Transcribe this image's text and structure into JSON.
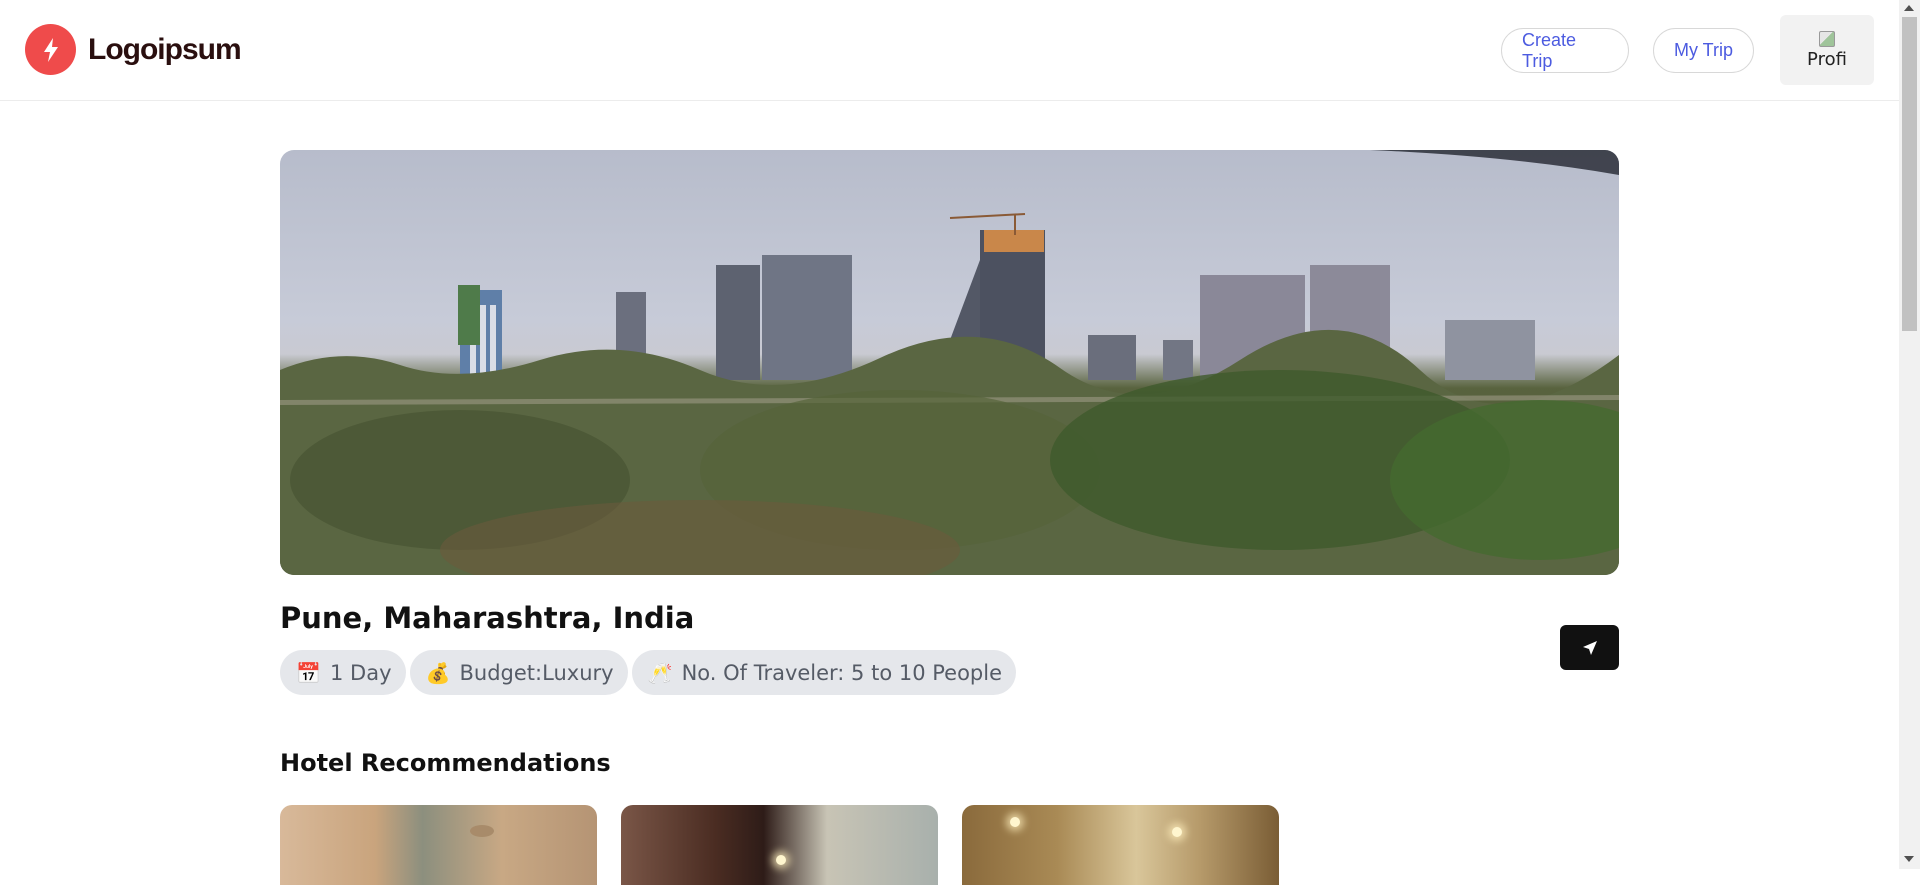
{
  "header": {
    "logo_text": "Logoipsum",
    "nav": {
      "create_trip": "Create Trip",
      "my_trip": "My Trip"
    },
    "avatar": {
      "alt_text": "Profi",
      "icon": "broken-image-icon"
    }
  },
  "hero": {
    "icon": "city-skyline-photo"
  },
  "trip": {
    "location": "Pune, Maharashtra, India",
    "chips": [
      {
        "icon": "calendar-icon",
        "glyph": "📅",
        "label": "1 Day"
      },
      {
        "icon": "money-bag-icon",
        "glyph": "💰",
        "label": "Budget:Luxury"
      },
      {
        "icon": "cheers-icon",
        "glyph": "🥂",
        "label": "No. Of Traveler: 5 to 10 People"
      }
    ],
    "share_icon": "send-icon"
  },
  "sections": {
    "hotels_title": "Hotel Recommendations"
  },
  "colors": {
    "brand_red": "#ef4b4b",
    "nav_text": "#4c5be0",
    "chip_bg": "#e5e7eb",
    "share_btn_bg": "#111111"
  }
}
